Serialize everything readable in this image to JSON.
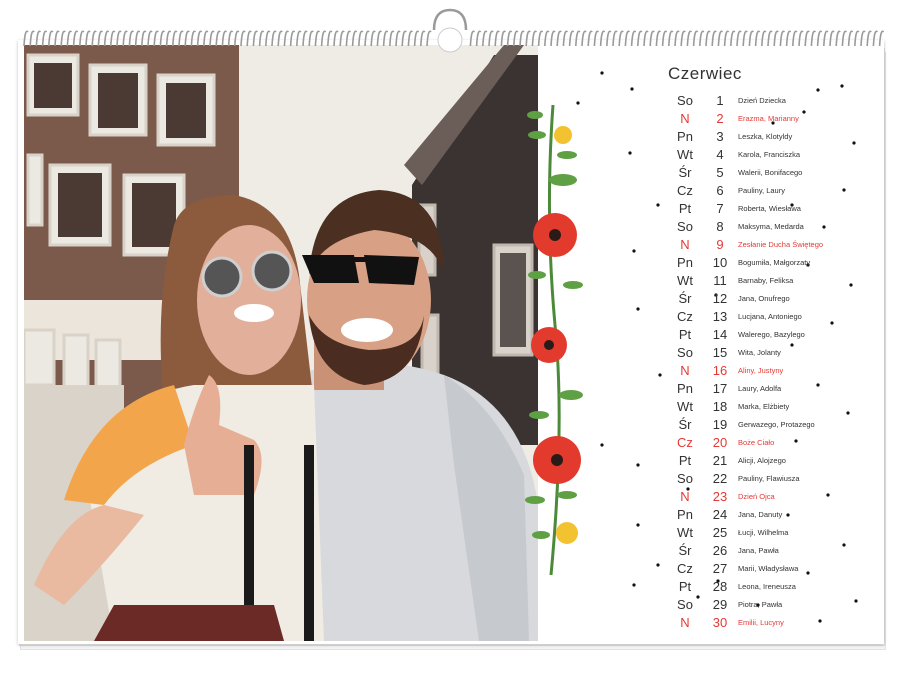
{
  "calendar": {
    "month": "Czerwiec",
    "accent_color": "#e53935",
    "text_color": "#333333",
    "days": [
      {
        "abbr": "So",
        "num": "1",
        "names": "Dzień Dziecka",
        "holiday": false
      },
      {
        "abbr": "N",
        "num": "2",
        "names": "Erazma, Marianny",
        "holiday": true
      },
      {
        "abbr": "Pn",
        "num": "3",
        "names": "Leszka, Klotyldy",
        "holiday": false
      },
      {
        "abbr": "Wt",
        "num": "4",
        "names": "Karola, Franciszka",
        "holiday": false
      },
      {
        "abbr": "Śr",
        "num": "5",
        "names": "Walerii, Bonifacego",
        "holiday": false
      },
      {
        "abbr": "Cz",
        "num": "6",
        "names": "Pauliny, Laury",
        "holiday": false
      },
      {
        "abbr": "Pt",
        "num": "7",
        "names": "Roberta, Wiesława",
        "holiday": false
      },
      {
        "abbr": "So",
        "num": "8",
        "names": "Maksyma, Medarda",
        "holiday": false
      },
      {
        "abbr": "N",
        "num": "9",
        "names": "Zesłanie Ducha Świętego",
        "holiday": true
      },
      {
        "abbr": "Pn",
        "num": "10",
        "names": "Bogumiła, Małgorzaty",
        "holiday": false
      },
      {
        "abbr": "Wt",
        "num": "11",
        "names": "Barnaby, Feliksa",
        "holiday": false
      },
      {
        "abbr": "Śr",
        "num": "12",
        "names": "Jana, Onufrego",
        "holiday": false
      },
      {
        "abbr": "Cz",
        "num": "13",
        "names": "Lucjana, Antoniego",
        "holiday": false
      },
      {
        "abbr": "Pt",
        "num": "14",
        "names": "Walerego, Bazylego",
        "holiday": false
      },
      {
        "abbr": "So",
        "num": "15",
        "names": "Wita, Jolanty",
        "holiday": false
      },
      {
        "abbr": "N",
        "num": "16",
        "names": "Aliny, Justyny",
        "holiday": true
      },
      {
        "abbr": "Pn",
        "num": "17",
        "names": "Laury, Adolfa",
        "holiday": false
      },
      {
        "abbr": "Wt",
        "num": "18",
        "names": "Marka, Elżbiety",
        "holiday": false
      },
      {
        "abbr": "Śr",
        "num": "19",
        "names": "Gerwazego, Protazego",
        "holiday": false
      },
      {
        "abbr": "Cz",
        "num": "20",
        "names": "Boże Ciało",
        "holiday": true
      },
      {
        "abbr": "Pt",
        "num": "21",
        "names": "Alicji, Alojzego",
        "holiday": false
      },
      {
        "abbr": "So",
        "num": "22",
        "names": "Pauliny, Flawiusza",
        "holiday": false
      },
      {
        "abbr": "N",
        "num": "23",
        "names": "Dzień Ojca",
        "holiday": true
      },
      {
        "abbr": "Pn",
        "num": "24",
        "names": "Jana, Danuty",
        "holiday": false
      },
      {
        "abbr": "Wt",
        "num": "25",
        "names": "Łucji, Wilhelma",
        "holiday": false
      },
      {
        "abbr": "Śr",
        "num": "26",
        "names": "Jana, Pawła",
        "holiday": false
      },
      {
        "abbr": "Cz",
        "num": "27",
        "names": "Marii, Władysława",
        "holiday": false
      },
      {
        "abbr": "Pt",
        "num": "28",
        "names": "Leona, Ireneusza",
        "holiday": false
      },
      {
        "abbr": "So",
        "num": "29",
        "names": "Piotra, Pawła",
        "holiday": false
      },
      {
        "abbr": "N",
        "num": "30",
        "names": "Emilii, Lucyny",
        "holiday": true
      }
    ]
  },
  "icons": {
    "binding": "spiral-wire-binding-icon",
    "hanger": "calendar-hanger-icon",
    "flowers": "poppy-flower-garland-icon"
  }
}
